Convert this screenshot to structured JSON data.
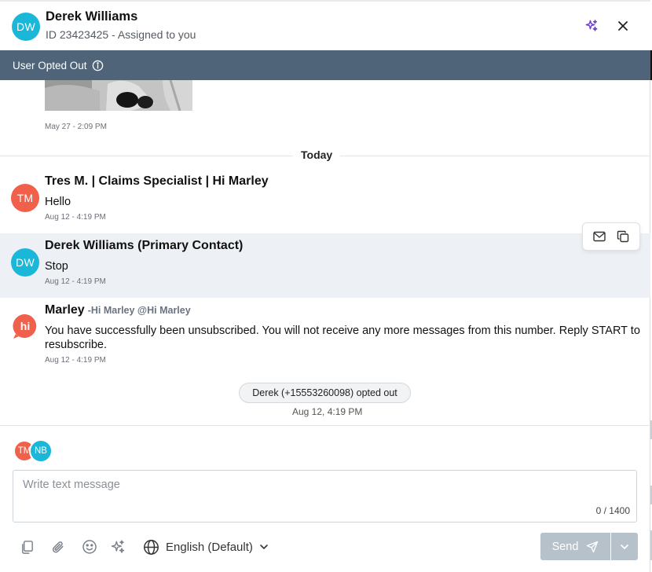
{
  "header": {
    "avatar_initials": "DW",
    "name": "Derek Williams",
    "subtitle": "ID 23423425 - Assigned to you",
    "sparkle_icon": "sparkle-icon",
    "close_icon": "close-icon"
  },
  "banner": {
    "text": "User Opted Out",
    "icon": "info-icon"
  },
  "messages": {
    "earlier_timestamp": "May 27 - 2:09 PM",
    "today_label": "Today",
    "msg1": {
      "initials": "TM",
      "sender": "Tres M. | Claims Specialist | Hi Marley",
      "text": "Hello",
      "timestamp": "Aug 12 - 4:19 PM"
    },
    "msg2": {
      "initials": "DW",
      "sender": "Derek Williams (Primary Contact)",
      "text": "Stop",
      "timestamp": "Aug 12 - 4:19 PM"
    },
    "msg3": {
      "logo": "hi",
      "sender": "Marley",
      "sender_sub": "-Hi Marley @Hi Marley",
      "text": "You have successfully been unsubscribed. You will not receive any more messages from this number. Reply START to resubscribe.",
      "timestamp": "Aug 12 - 4:19 PM"
    },
    "system_event": "Derek (+15553260098) opted out",
    "system_timestamp": "Aug 12, 4:19 PM"
  },
  "composer": {
    "participants": [
      "TM",
      "NB"
    ],
    "placeholder": "Write text message",
    "char_count": "0 / 1400",
    "language": "English (Default)",
    "send_label": "Send"
  },
  "colors": {
    "banner": "#4f6478",
    "avatar_customer": "#1ab7d8",
    "avatar_agent": "#f0604a",
    "send_disabled": "#b7c1ca"
  }
}
